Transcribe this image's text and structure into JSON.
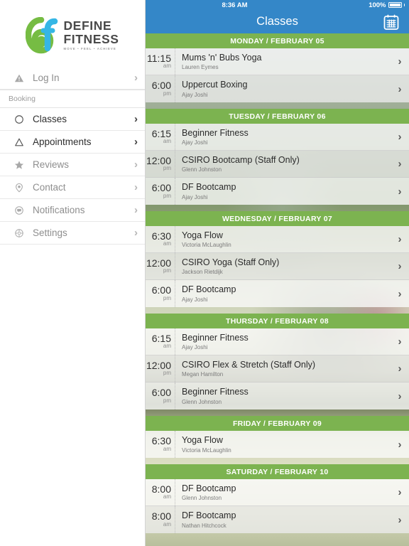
{
  "sidebar": {
    "logo": {
      "line1": "DEFINE",
      "line2": "FITNESS",
      "tagline": "MOVE  •  FEEL  •  ACHIEVE"
    },
    "section_label": "Booking",
    "items": [
      {
        "label": "Log In",
        "icon": "alert-triangle-icon",
        "active": false
      },
      {
        "label": "Classes",
        "icon": "circle-icon",
        "active": true
      },
      {
        "label": "Appointments",
        "icon": "triangle-icon",
        "active": true
      },
      {
        "label": "Reviews",
        "icon": "star-icon",
        "active": false
      },
      {
        "label": "Contact",
        "icon": "map-pin-icon",
        "active": false
      },
      {
        "label": "Notifications",
        "icon": "chat-bubble-icon",
        "active": false
      },
      {
        "label": "Settings",
        "icon": "gear-icon",
        "active": false
      }
    ]
  },
  "statusbar": {
    "time": "8:36 AM",
    "battery_percent": "100%"
  },
  "navbar": {
    "title": "Classes",
    "right_icon": "calendar-icon"
  },
  "colors": {
    "header_blue": "#3487c8",
    "day_green": "#7cb350"
  },
  "schedule": [
    {
      "day_label": "MONDAY / FEBRUARY 05",
      "classes": [
        {
          "time": "11:15",
          "meridiem": "am",
          "title": "Mums 'n' Bubs Yoga",
          "instructor": "Lauren Eymes"
        },
        {
          "time": "6:00",
          "meridiem": "pm",
          "title": "Uppercut Boxing",
          "instructor": "Ajay Joshi"
        }
      ]
    },
    {
      "day_label": "TUESDAY / FEBRUARY 06",
      "classes": [
        {
          "time": "6:15",
          "meridiem": "am",
          "title": "Beginner Fitness",
          "instructor": "Ajay Joshi"
        },
        {
          "time": "12:00",
          "meridiem": "pm",
          "title": "CSIRO Bootcamp (Staff Only)",
          "instructor": "Glenn Johnston"
        },
        {
          "time": "6:00",
          "meridiem": "pm",
          "title": "DF Bootcamp",
          "instructor": "Ajay Joshi"
        }
      ]
    },
    {
      "day_label": "WEDNESDAY / FEBRUARY 07",
      "classes": [
        {
          "time": "6:30",
          "meridiem": "am",
          "title": "Yoga Flow",
          "instructor": "Victoria McLaughlin"
        },
        {
          "time": "12:00",
          "meridiem": "pm",
          "title": "CSIRO Yoga (Staff Only)",
          "instructor": "Jackson Rietdijk"
        },
        {
          "time": "6:00",
          "meridiem": "pm",
          "title": "DF Bootcamp",
          "instructor": "Ajay Joshi"
        }
      ]
    },
    {
      "day_label": "THURSDAY / FEBRUARY 08",
      "classes": [
        {
          "time": "6:15",
          "meridiem": "am",
          "title": "Beginner Fitness",
          "instructor": "Ajay Joshi"
        },
        {
          "time": "12:00",
          "meridiem": "pm",
          "title": "CSIRO Flex & Stretch (Staff Only)",
          "instructor": "Megan Hamilton"
        },
        {
          "time": "6:00",
          "meridiem": "pm",
          "title": "Beginner Fitness",
          "instructor": "Glenn Johnston"
        }
      ]
    },
    {
      "day_label": "FRIDAY / FEBRUARY 09",
      "classes": [
        {
          "time": "6:30",
          "meridiem": "am",
          "title": "Yoga Flow",
          "instructor": "Victoria McLaughlin"
        }
      ]
    },
    {
      "day_label": "SATURDAY / FEBRUARY 10",
      "classes": [
        {
          "time": "8:00",
          "meridiem": "am",
          "title": "DF Bootcamp",
          "instructor": "Glenn Johnston"
        },
        {
          "time": "8:00",
          "meridiem": "am",
          "title": "DF Bootcamp",
          "instructor": "Nathan Hitchcock"
        }
      ]
    }
  ]
}
